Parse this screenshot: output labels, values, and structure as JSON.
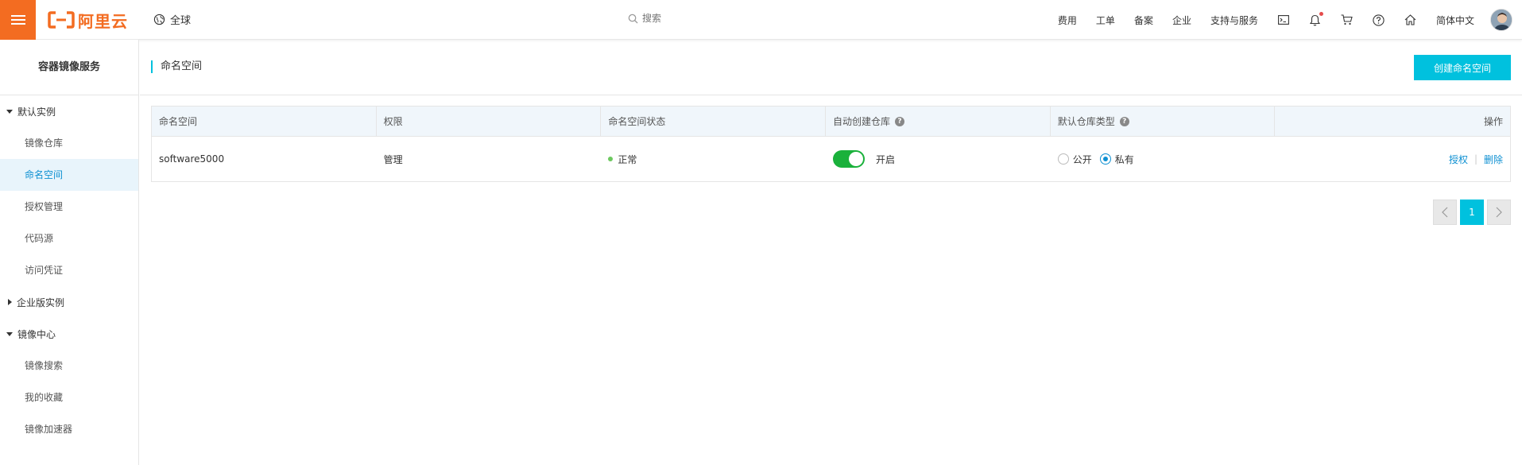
{
  "header": {
    "logo_text": "阿里云",
    "region": "全球",
    "search_placeholder": "搜索",
    "links": [
      "费用",
      "工单",
      "备案",
      "企业",
      "支持与服务"
    ],
    "language": "简体中文"
  },
  "sidebar": {
    "title": "容器镜像服务",
    "groups": [
      {
        "label": "默认实例",
        "expanded": true,
        "items": [
          "镜像仓库",
          "命名空间",
          "授权管理",
          "代码源",
          "访问凭证"
        ]
      },
      {
        "label": "企业版实例",
        "expanded": false,
        "items": []
      },
      {
        "label": "镜像中心",
        "expanded": true,
        "items": [
          "镜像搜索",
          "我的收藏",
          "镜像加速器"
        ]
      }
    ],
    "active_item": "命名空间"
  },
  "main": {
    "title": "命名空间",
    "create_button": "创建命名空间",
    "table": {
      "columns": [
        "命名空间",
        "权限",
        "命名空间状态",
        "自动创建仓库",
        "默认仓库类型",
        "操作"
      ],
      "rows": [
        {
          "namespace": "software5000",
          "permission": "管理",
          "status": "正常",
          "auto_create": "开启",
          "auto_create_on": true,
          "repo_type_options": [
            "公开",
            "私有"
          ],
          "repo_type_selected": "私有",
          "actions": [
            "授权",
            "删除"
          ]
        }
      ]
    },
    "pagination": {
      "current": "1"
    }
  },
  "colors": {
    "brand_orange": "#f36c21",
    "accent_cyan": "#00c1de",
    "link_blue": "#0e90d2",
    "toggle_green": "#1ab13b",
    "status_green": "#6cc95f"
  }
}
